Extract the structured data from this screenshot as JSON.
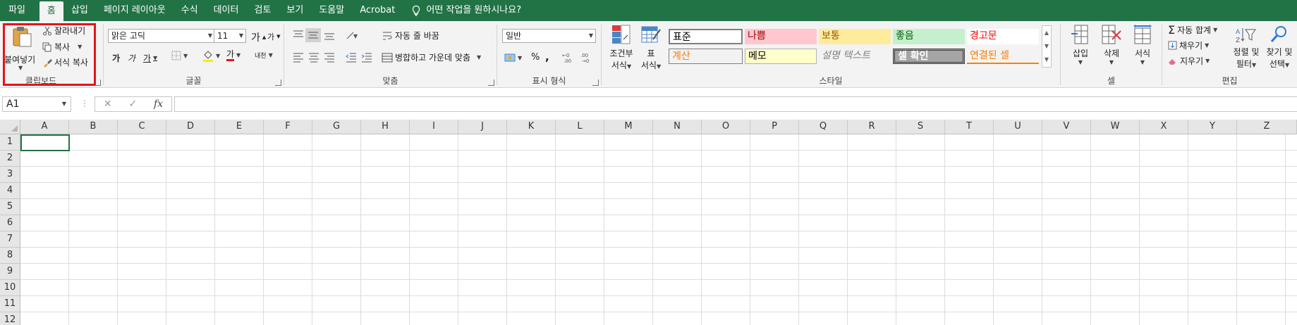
{
  "menu": [
    "파일",
    "홈",
    "삽입",
    "페이지 레이아웃",
    "수식",
    "데이터",
    "검토",
    "보기",
    "도움말",
    "Acrobat"
  ],
  "tell_me": "어떤 작업을 원하시나요?",
  "clipboard": {
    "paste": "붙여넣기",
    "cut": "잘라내기",
    "copy": "복사",
    "format_painter": "서식 복사",
    "label": "클립보드"
  },
  "font": {
    "name": "맑은 고딕",
    "size": "11",
    "grow": "가",
    "shrink": "가",
    "bold": "가",
    "italic": "가",
    "underline": "가",
    "font_color": "가",
    "phonetic": "내천",
    "label": "글꼴"
  },
  "alignment": {
    "wrap_text": "자동 줄 바꿈",
    "merge_center": "병합하고 가운데 맞춤",
    "label": "맞춤"
  },
  "number": {
    "format": "일반",
    "percent": "%",
    "comma": ",",
    "label": "표시 형식"
  },
  "styles": {
    "conditional": "조건부",
    "conditional2": "서식",
    "table": "표",
    "table2": "서식",
    "cells": [
      "표준",
      "나쁨",
      "보통",
      "좋음",
      "경고문",
      "계산",
      "메모",
      "설명 텍스트",
      "셀 확인",
      "연결된 셀"
    ],
    "label": "스타일"
  },
  "cells_group": {
    "insert": "삽입",
    "delete": "삭제",
    "format": "서식",
    "label": "셀"
  },
  "editing": {
    "autosum": "자동 합계",
    "fill": "채우기",
    "clear": "지우기",
    "sort_filter": "정렬 및",
    "sort_filter2": "필터",
    "find_select": "찾기 및",
    "find_select2": "선택",
    "label": "편집"
  },
  "formula_bar": {
    "name_box": "A1",
    "fx": "fx"
  },
  "columns": [
    "A",
    "B",
    "C",
    "D",
    "E",
    "F",
    "G",
    "H",
    "I",
    "J",
    "K",
    "L",
    "M",
    "N",
    "O",
    "P",
    "Q",
    "R",
    "S",
    "T",
    "U",
    "V",
    "W",
    "X",
    "Y",
    "Z"
  ],
  "rows": [
    "1",
    "2",
    "3",
    "4",
    "5",
    "6",
    "7",
    "8",
    "9",
    "10",
    "11",
    "12"
  ],
  "colors": {
    "excel_green": "#217346",
    "highlight_red": "#e3141b"
  }
}
